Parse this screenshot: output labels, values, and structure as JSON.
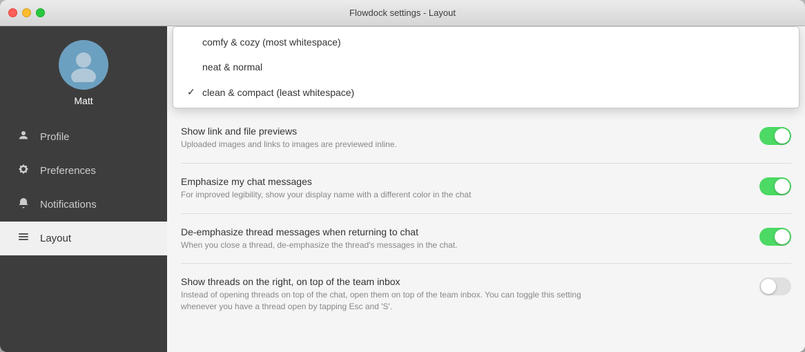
{
  "window": {
    "title": "Flowdock settings - Layout"
  },
  "sidebar": {
    "user_name": "Matt",
    "items": [
      {
        "id": "profile",
        "label": "Profile",
        "icon": "person",
        "active": false
      },
      {
        "id": "preferences",
        "label": "Preferences",
        "icon": "gear",
        "active": false
      },
      {
        "id": "notifications",
        "label": "Notifications",
        "icon": "bell",
        "active": false
      },
      {
        "id": "layout",
        "label": "Layout",
        "icon": "lines",
        "active": true
      }
    ]
  },
  "dropdown": {
    "items": [
      {
        "label": "comfy & cozy (most whitespace)",
        "selected": false,
        "checkmark": ""
      },
      {
        "label": "neat & normal",
        "selected": false,
        "checkmark": ""
      },
      {
        "label": "clean & compact (least whitespace)",
        "selected": true,
        "checkmark": "✓"
      }
    ]
  },
  "settings": [
    {
      "id": "link-previews",
      "title": "Show link and file previews",
      "desc": "Uploaded images and links to images are previewed inline.",
      "on": true
    },
    {
      "id": "emphasize-chat",
      "title": "Emphasize my chat messages",
      "desc": "For improved legibility, show your display name with a different color in the chat",
      "on": true
    },
    {
      "id": "deemphasize-thread",
      "title": "De-emphasize thread messages when returning to chat",
      "desc": "When you close a thread, de-emphasize the thread's messages in the chat.",
      "on": true
    },
    {
      "id": "threads-right",
      "title": "Show threads on the right, on top of the team inbox",
      "desc": "Instead of opening threads on top of the chat, open them on top of the team inbox. You can toggle this setting whenever you have a thread open by tapping Esc and 'S'.",
      "on": false
    }
  ],
  "traffic_lights": {
    "close_label": "close",
    "min_label": "minimize",
    "max_label": "maximize"
  }
}
